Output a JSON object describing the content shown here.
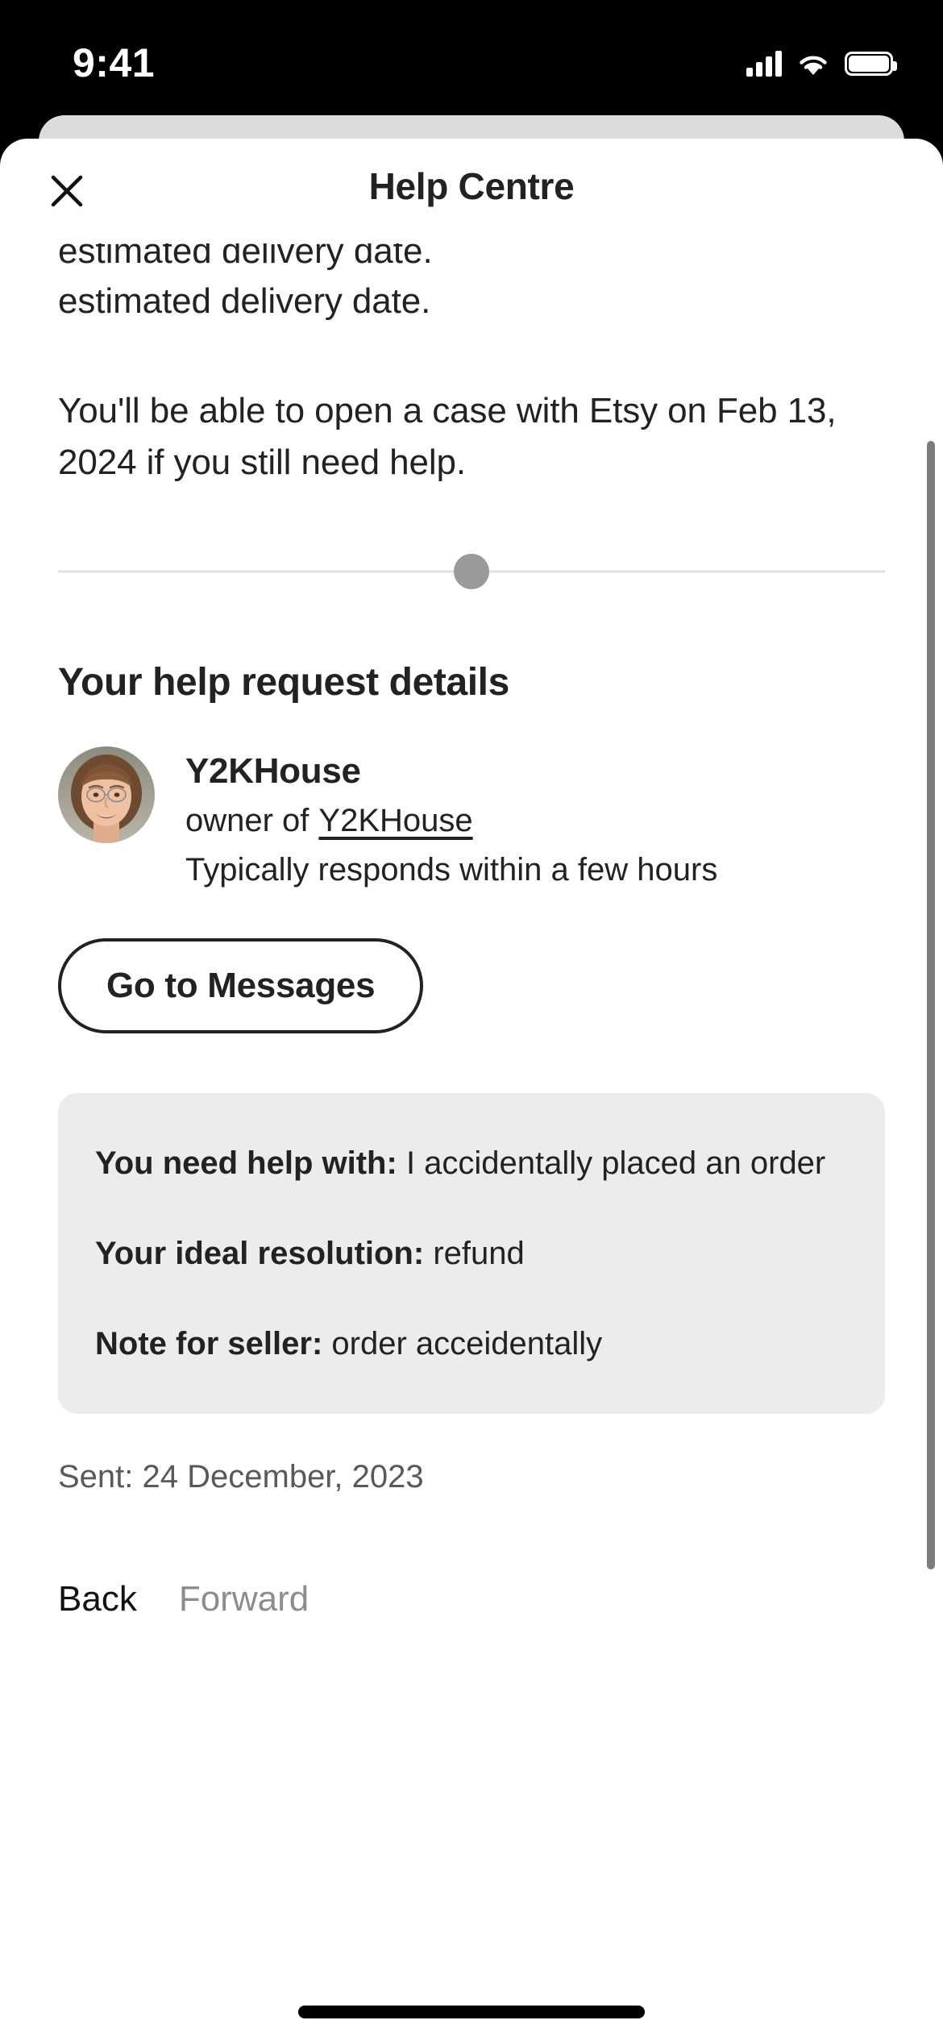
{
  "status_bar": {
    "time": "9:41",
    "icons": [
      "cellular-signal-icon",
      "wifi-icon",
      "battery-icon"
    ]
  },
  "header": {
    "title": "Help Centre",
    "close_icon": "close-icon"
  },
  "content": {
    "clipped_line": "estimated delivery date.",
    "paragraph_1": "estimated delivery date.",
    "paragraph_2": "You'll be able to open a case with Etsy on Feb 13, 2024 if you still need help.",
    "section_title": "Your help request details"
  },
  "seller": {
    "name": "Y2KHouse",
    "owner_prefix": "owner of",
    "shop_link": "Y2KHouse",
    "response_time": "Typically responds within a few hours",
    "avatar": "seller-avatar-photo"
  },
  "actions": {
    "go_to_messages": "Go to Messages"
  },
  "request_details": [
    {
      "label": "You need help with:",
      "value": "I accidentally placed an order"
    },
    {
      "label": "Your ideal resolution:",
      "value": "refund"
    },
    {
      "label": "Note for seller:",
      "value": "order acceidentally"
    }
  ],
  "sent": "Sent: 24 December, 2023",
  "bottom_nav": {
    "back": "Back",
    "forward": "Forward"
  },
  "colors": {
    "text_primary": "#222222",
    "text_muted": "#595959",
    "text_disabled": "#8d8d8d",
    "card_bg": "#ececed",
    "sheet_behind": "#dcdbdd",
    "progress_dot": "#9a9a9c",
    "progress_track": "#e1e3e1",
    "scrollbar": "#7d7d7d"
  }
}
